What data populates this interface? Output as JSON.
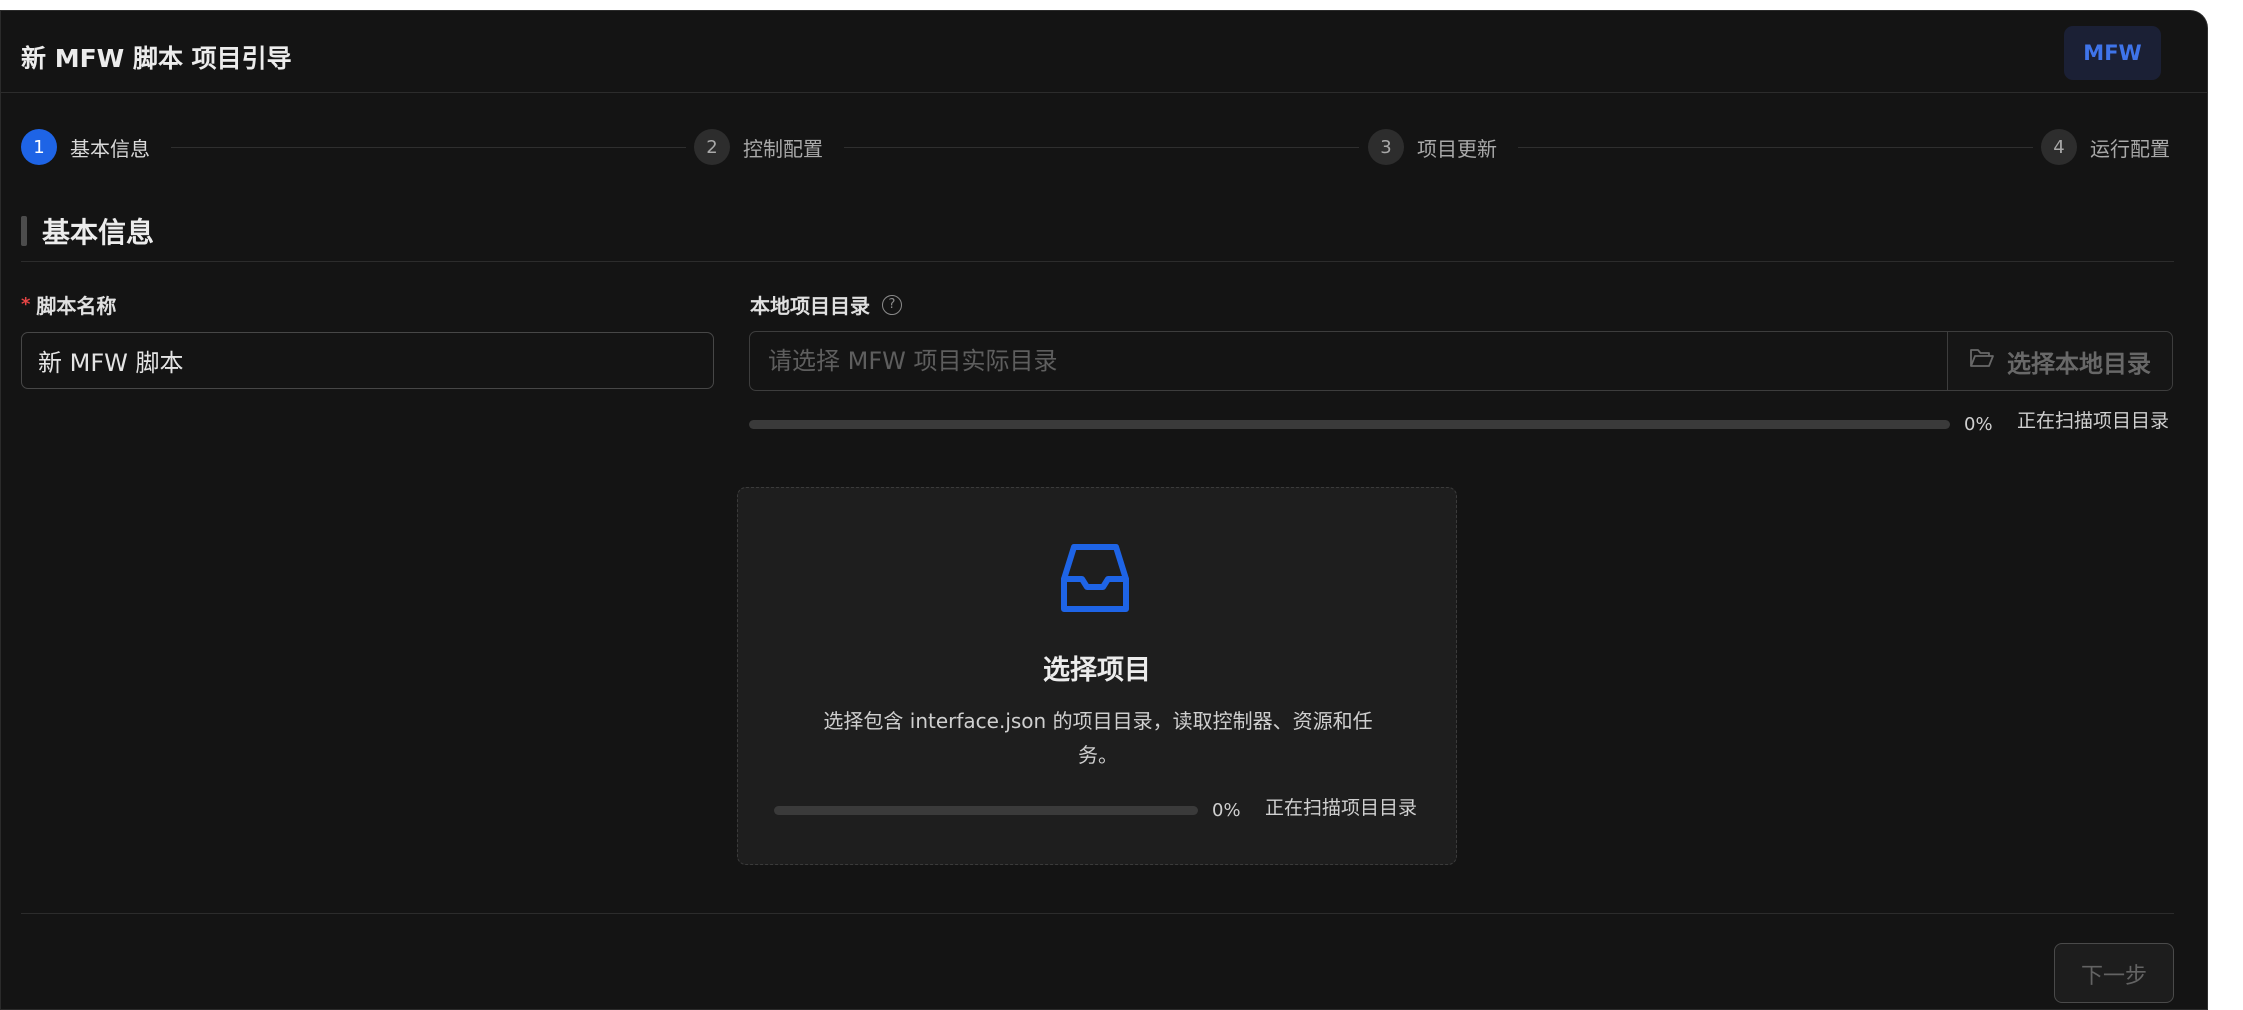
{
  "header": {
    "title": "新 MFW 脚本 项目引导",
    "badge": "MFW"
  },
  "steps": [
    {
      "number": "1",
      "label": "基本信息",
      "active": true
    },
    {
      "number": "2",
      "label": "控制配置",
      "active": false
    },
    {
      "number": "3",
      "label": "项目更新",
      "active": false
    },
    {
      "number": "4",
      "label": "运行配置",
      "active": false
    }
  ],
  "section": {
    "title": "基本信息"
  },
  "form": {
    "script_name": {
      "required_mark": "*",
      "label": "脚本名称",
      "value": "新 MFW 脚本"
    },
    "local_dir": {
      "label": "本地项目目录",
      "help_icon": "?",
      "placeholder": "请选择 MFW 项目实际目录",
      "button_label": "选择本地目录",
      "button_icon": "folder-open-icon",
      "progress_percent": 0,
      "progress_label": "0%",
      "status": "正在扫描项目目录"
    }
  },
  "select_card": {
    "icon": "inbox-icon",
    "title": "选择项目",
    "description": "选择包含 interface.json 的项目目录，读取控制器、资源和任务。",
    "progress_percent": 0,
    "progress_label": "0%",
    "status": "正在扫描项目目录"
  },
  "footer": {
    "next_label": "下一步"
  },
  "colors": {
    "accent": "#1e64e6",
    "background": "#141414",
    "required": "#e54545"
  }
}
